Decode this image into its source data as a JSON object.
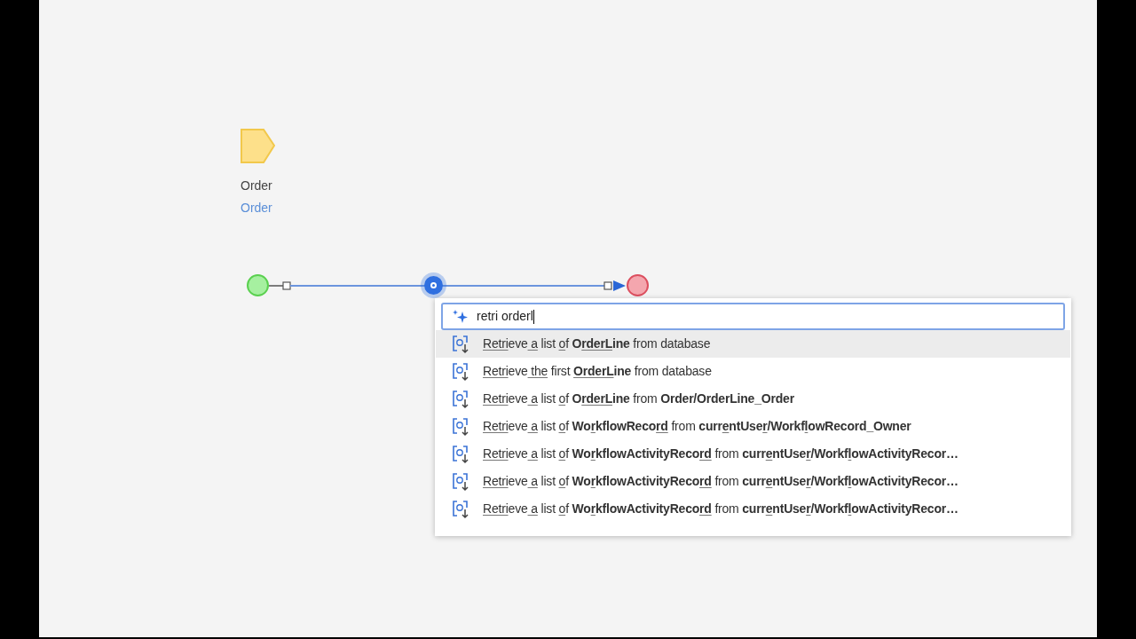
{
  "canvas": {
    "nodes": [
      {
        "kind": "parameter",
        "title": "Order",
        "subtitle": "Order"
      },
      {
        "kind": "start"
      },
      {
        "kind": "insert",
        "selected": true
      },
      {
        "kind": "end"
      }
    ]
  },
  "search": {
    "value": "retri orderl"
  },
  "suggestions": [
    {
      "selected": true,
      "parts": [
        {
          "t": "Retri",
          "u": true
        },
        {
          "t": "eve"
        },
        {
          "t": " a",
          "u": true
        },
        {
          "t": " list "
        },
        {
          "t": "o",
          "u": true
        },
        {
          "t": "f "
        },
        {
          "t": "O",
          "b": true
        },
        {
          "t": "rderL",
          "b": true,
          "u": true
        },
        {
          "t": "ine",
          "b": true
        },
        {
          "t": " from database"
        }
      ]
    },
    {
      "selected": false,
      "parts": [
        {
          "t": "Retri",
          "u": true
        },
        {
          "t": "eve"
        },
        {
          "t": " the",
          "u": true
        },
        {
          "t": " first "
        },
        {
          "t": "OrderL",
          "b": true,
          "u": true
        },
        {
          "t": "ine",
          "b": true
        },
        {
          "t": " from database"
        }
      ]
    },
    {
      "selected": false,
      "parts": [
        {
          "t": "Retri",
          "u": true
        },
        {
          "t": "eve"
        },
        {
          "t": " a",
          "u": true
        },
        {
          "t": " list "
        },
        {
          "t": "o",
          "u": true
        },
        {
          "t": "f "
        },
        {
          "t": "O",
          "b": true
        },
        {
          "t": "rderL",
          "b": true,
          "u": true
        },
        {
          "t": "ine",
          "b": true
        },
        {
          "t": " from "
        },
        {
          "t": "Order/OrderLine_Order",
          "b": true
        }
      ]
    },
    {
      "selected": false,
      "parts": [
        {
          "t": "Retri",
          "u": true
        },
        {
          "t": "eve"
        },
        {
          "t": " a",
          "u": true
        },
        {
          "t": " list "
        },
        {
          "t": "o",
          "u": true
        },
        {
          "t": "f "
        },
        {
          "t": "Wo",
          "b": true
        },
        {
          "t": "r",
          "b": true,
          "u": true
        },
        {
          "t": "kflowReco",
          "b": true
        },
        {
          "t": "rd",
          "b": true,
          "u": true
        },
        {
          "t": " from "
        },
        {
          "t": "curr",
          "b": true
        },
        {
          "t": "e",
          "b": true,
          "u": true
        },
        {
          "t": "ntUse",
          "b": true
        },
        {
          "t": "r",
          "b": true,
          "u": true
        },
        {
          "t": "/Workf",
          "b": true
        },
        {
          "t": "l",
          "b": true,
          "u": true
        },
        {
          "t": "owRecord_Owner",
          "b": true
        }
      ]
    },
    {
      "selected": false,
      "parts": [
        {
          "t": "Retri",
          "u": true
        },
        {
          "t": "eve"
        },
        {
          "t": " a",
          "u": true
        },
        {
          "t": " list "
        },
        {
          "t": "o",
          "u": true
        },
        {
          "t": "f "
        },
        {
          "t": "Wo",
          "b": true
        },
        {
          "t": "r",
          "b": true,
          "u": true
        },
        {
          "t": "kflowActivityReco",
          "b": true
        },
        {
          "t": "rd",
          "b": true,
          "u": true
        },
        {
          "t": " from "
        },
        {
          "t": "curr",
          "b": true
        },
        {
          "t": "e",
          "b": true,
          "u": true
        },
        {
          "t": "ntUse",
          "b": true
        },
        {
          "t": "r",
          "b": true,
          "u": true
        },
        {
          "t": "/Workf",
          "b": true
        },
        {
          "t": "l",
          "b": true,
          "u": true
        },
        {
          "t": "owActivityRecor…",
          "b": true
        }
      ]
    },
    {
      "selected": false,
      "parts": [
        {
          "t": "Retri",
          "u": true
        },
        {
          "t": "eve"
        },
        {
          "t": " a",
          "u": true
        },
        {
          "t": " list "
        },
        {
          "t": "o",
          "u": true
        },
        {
          "t": "f "
        },
        {
          "t": "Wo",
          "b": true
        },
        {
          "t": "r",
          "b": true,
          "u": true
        },
        {
          "t": "kflowActivityReco",
          "b": true
        },
        {
          "t": "rd",
          "b": true,
          "u": true
        },
        {
          "t": " from "
        },
        {
          "t": "curr",
          "b": true
        },
        {
          "t": "e",
          "b": true,
          "u": true
        },
        {
          "t": "ntUse",
          "b": true
        },
        {
          "t": "r",
          "b": true,
          "u": true
        },
        {
          "t": "/Workf",
          "b": true
        },
        {
          "t": "l",
          "b": true,
          "u": true
        },
        {
          "t": "owActivityRecor…",
          "b": true
        }
      ]
    },
    {
      "selected": false,
      "parts": [
        {
          "t": "Retri",
          "u": true
        },
        {
          "t": "eve"
        },
        {
          "t": " a",
          "u": true
        },
        {
          "t": " list "
        },
        {
          "t": "o",
          "u": true
        },
        {
          "t": "f "
        },
        {
          "t": "Wo",
          "b": true
        },
        {
          "t": "r",
          "b": true,
          "u": true
        },
        {
          "t": "kflowActivityReco",
          "b": true
        },
        {
          "t": "rd",
          "b": true,
          "u": true
        },
        {
          "t": " from "
        },
        {
          "t": "curr",
          "b": true
        },
        {
          "t": "e",
          "b": true,
          "u": true
        },
        {
          "t": "ntUse",
          "b": true
        },
        {
          "t": "r",
          "b": true,
          "u": true
        },
        {
          "t": "/Workf",
          "b": true
        },
        {
          "t": "l",
          "b": true,
          "u": true
        },
        {
          "t": "owActivityRecor…",
          "b": true
        }
      ]
    }
  ]
}
